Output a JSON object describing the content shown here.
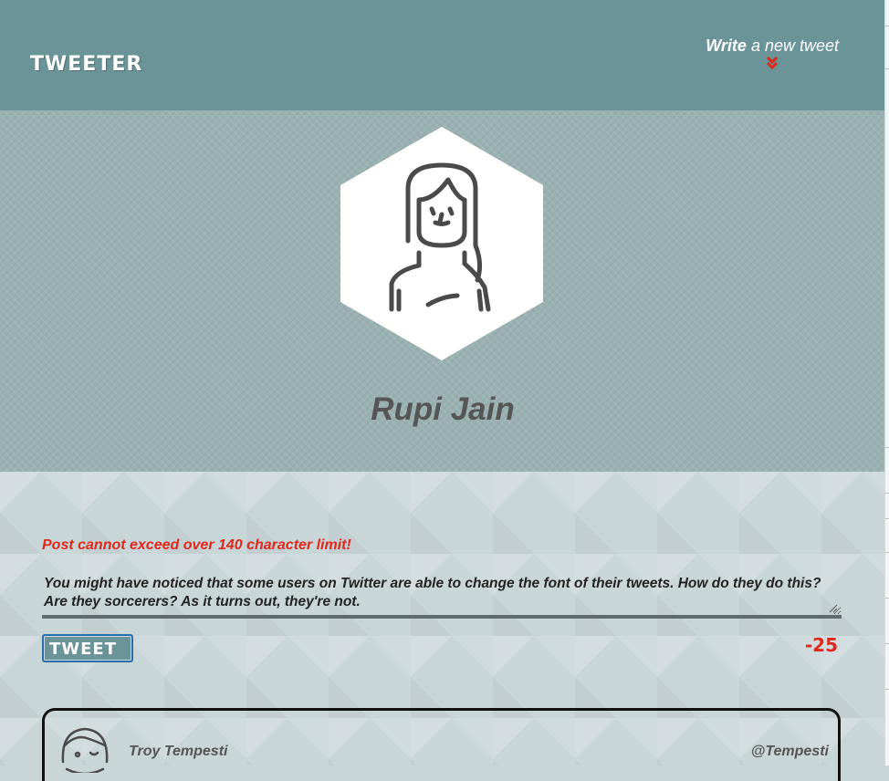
{
  "nav": {
    "brand": "TWEETER",
    "compose_bold": "Write",
    "compose_rest": " a new tweet",
    "chevron_color": "#e0281d"
  },
  "profile": {
    "name": "Rupi Jain",
    "avatar": "woman-avatar-icon"
  },
  "composer": {
    "error": "Post cannot exceed over 140 character limit!",
    "text": "You might have noticed that some users on Twitter are able to change the font of their tweets. How do they do this? Are they sorcerers? As it turns out, they're not.",
    "button_label": "TWEET",
    "counter": "-25"
  },
  "tweets": [
    {
      "name": "Troy Tempesti",
      "handle": "@Tempesti",
      "avatar": "man-avatar-icon"
    }
  ],
  "colors": {
    "nav": "#6a9497",
    "accent_red": "#e0281d",
    "text_gray": "#555555"
  }
}
